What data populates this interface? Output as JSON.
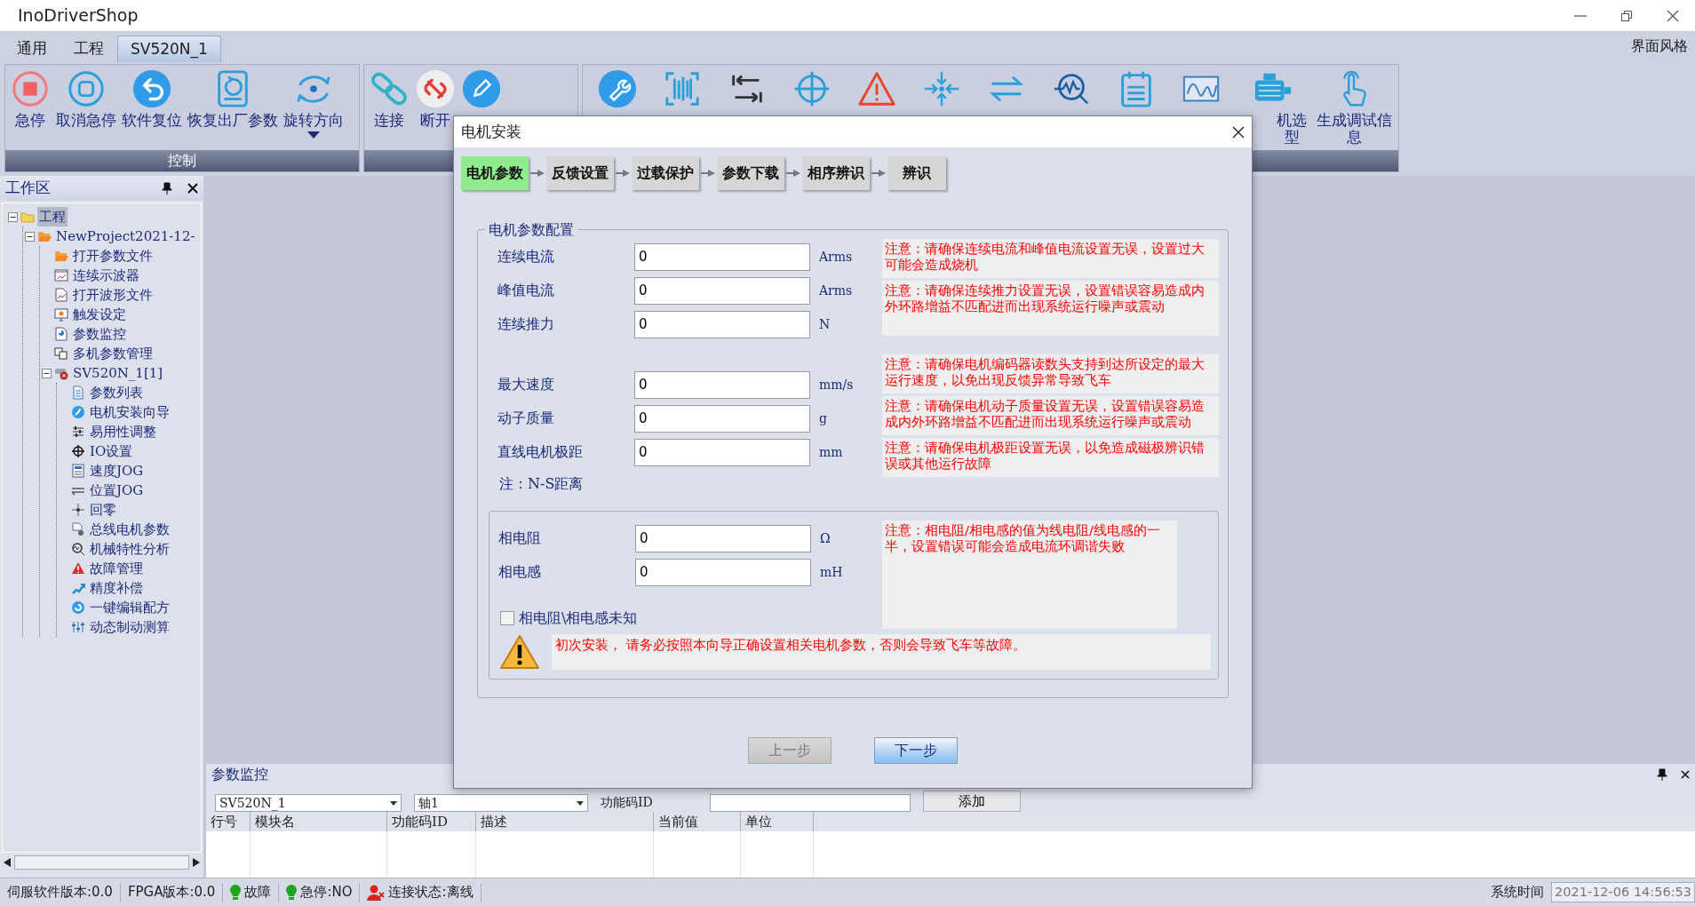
{
  "window": {
    "title": "InoDriverShop"
  },
  "menu_tabs": [
    {
      "label": "通用",
      "selected": false
    },
    {
      "label": "工程",
      "selected": false
    },
    {
      "label": "SV520N_1",
      "selected": true
    }
  ],
  "theme_link": "界面风格",
  "ribbon": [
    {
      "label": "控制",
      "buttons": [
        {
          "kind": "button",
          "label": "急停"
        },
        {
          "kind": "button",
          "label": "取消急停"
        },
        {
          "kind": "button",
          "label": "软件复位"
        },
        {
          "kind": "button",
          "label": "恢复出厂参数"
        },
        {
          "kind": "menu-button",
          "label": "旋转方向"
        }
      ]
    },
    {
      "buttons": [
        {
          "kind": "button",
          "label": "连接"
        },
        {
          "kind": "button",
          "label": "断开"
        },
        {
          "kind": "icon-only"
        }
      ]
    },
    {
      "buttons": [
        {
          "kind": "icon-only"
        },
        {
          "kind": "icon-only"
        },
        {
          "kind": "icon-only"
        },
        {
          "kind": "icon-only"
        },
        {
          "kind": "icon-only"
        },
        {
          "kind": "icon-only"
        },
        {
          "kind": "icon-only"
        },
        {
          "kind": "icon-only"
        },
        {
          "kind": "icon-only"
        },
        {
          "kind": "icon-only"
        },
        {
          "kind": "button",
          "label": "机选型"
        },
        {
          "kind": "button",
          "label": "生成调试信息"
        }
      ]
    }
  ],
  "workspace": {
    "title": "工作区",
    "tree": [
      {
        "label": "工程",
        "selected": true,
        "expanded": true,
        "children": [
          {
            "label": "NewProject2021-12-",
            "selected": false,
            "expanded": true,
            "children": [
              {
                "label": "打开参数文件",
                "selected": false
              },
              {
                "label": "连续示波器",
                "selected": false
              },
              {
                "label": "打开波形文件",
                "selected": false
              },
              {
                "label": "触发设定",
                "selected": false
              },
              {
                "label": "参数监控",
                "selected": false
              },
              {
                "label": "多机参数管理",
                "selected": false
              },
              {
                "label": "SV520N_1[1]",
                "selected": false,
                "expanded": true,
                "children": [
                  {
                    "label": "参数列表",
                    "selected": false
                  },
                  {
                    "label": "电机安装向导",
                    "selected": false
                  },
                  {
                    "label": "易用性调整",
                    "selected": false
                  },
                  {
                    "label": "IO设置",
                    "selected": false
                  },
                  {
                    "label": "速度JOG",
                    "selected": false
                  },
                  {
                    "label": "位置JOG",
                    "selected": false
                  },
                  {
                    "label": "回零",
                    "selected": false
                  },
                  {
                    "label": "总线电机参数",
                    "selected": false
                  },
                  {
                    "label": "机械特性分析",
                    "selected": false
                  },
                  {
                    "label": "故障管理",
                    "selected": false
                  },
                  {
                    "label": "精度补偿",
                    "selected": false
                  },
                  {
                    "label": "一键编辑配方",
                    "selected": false
                  },
                  {
                    "label": "动态制动测算",
                    "selected": false
                  }
                ]
              }
            ]
          }
        ]
      }
    ]
  },
  "monitor_panel": {
    "title": "参数监控",
    "device_select": "SV520N_1",
    "axis_select": "轴1",
    "code_label": "功能码ID",
    "add_button": "添加",
    "columns": [
      "行号",
      "模块名",
      "功能码ID",
      "描述",
      "当前值",
      "单位"
    ]
  },
  "status_bar": {
    "items": [
      {
        "kind": "text",
        "label": "伺服软件版本:0.0"
      },
      {
        "kind": "text",
        "label": "FPGA版本:0.0"
      },
      {
        "kind": "bulb",
        "label": "故障",
        "color": "#1fa51f"
      },
      {
        "kind": "bulb",
        "label": "急停:NO",
        "color": "#1fa51f"
      },
      {
        "kind": "person",
        "label": "连接状态:离线",
        "color": "#dd2020"
      }
    ],
    "time_label": "系统时间",
    "time": "2021-12-06 14:56:53"
  },
  "dialog": {
    "title": "电机安装",
    "steps": [
      {
        "label": "电机参数",
        "selected": true
      },
      {
        "label": "反馈设置",
        "selected": false
      },
      {
        "label": "过载保护",
        "selected": false
      },
      {
        "label": "参数下载",
        "selected": false
      },
      {
        "label": "相序辨识",
        "selected": false
      },
      {
        "label": "辨识",
        "selected": false
      }
    ],
    "section_title": "电机参数配置",
    "groups": [
      {
        "rows": [
          {
            "label": "连续电流",
            "value": "0",
            "unit": "Arms"
          },
          {
            "label": "峰值电流",
            "value": "0",
            "unit": "Arms"
          },
          {
            "label": "连续推力",
            "value": "0",
            "unit": "N"
          }
        ],
        "notes": [
          "注意：请确保连续电流和峰值电流设置无误，设置过大可能会造成烧机",
          "注意：请确保连续推力设置无误，设置错误容易造成内外环路增益不匹配进而出现系统运行噪声或震动"
        ]
      },
      {
        "rows": [
          {
            "label": "最大速度",
            "value": "0",
            "unit": "mm/s"
          },
          {
            "label": "动子质量",
            "value": "0",
            "unit": "g"
          },
          {
            "label": "直线电机极距",
            "value": "0",
            "unit": "mm"
          }
        ],
        "footnote": "注：N-S距离",
        "notes": [
          "注意：请确保电机编码器读数头支持到达所设定的最大运行速度，以免出现反馈异常导致飞车",
          "注意：请确保电机动子质量设置无误，设置错误容易造成内外环路增益不匹配进而出现系统运行噪声或震动",
          "注意：请确保电机极距设置无误，以免造成磁极辨识错误或其他运行故障"
        ]
      }
    ],
    "phase": {
      "rows": [
        {
          "label": "相电阻",
          "value": "0",
          "unit": "Ω"
        },
        {
          "label": "相电感",
          "value": "0",
          "unit": "mH"
        }
      ],
      "note": "注意：相电阻/相电感的值为线电阻/线电感的一半，设置错误可能会造成电流环调谐失败",
      "checkbox": {
        "label": "相电阻\\相电感未知",
        "checked": false
      },
      "warning": "初次安装， 请务必按照本向导正确设置相关电机参数，否则会导致飞车等故障。"
    },
    "buttons": [
      {
        "label": "上一步",
        "disabled": true
      },
      {
        "label": "下一步",
        "disabled": false
      }
    ]
  }
}
